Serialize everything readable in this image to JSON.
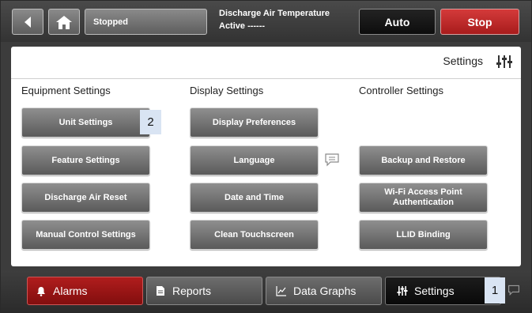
{
  "topbar": {
    "status": "Stopped",
    "info_title": "Discharge Air Temperature",
    "info_status": "Active ------",
    "auto_label": "Auto",
    "stop_label": "Stop"
  },
  "main": {
    "title": "Settings",
    "columns": [
      {
        "heading": "Equipment Settings",
        "buttons": [
          "Unit Settings",
          "Feature Settings",
          "Discharge Air Reset",
          "Manual Control Settings"
        ]
      },
      {
        "heading": "Display Settings",
        "buttons": [
          "Display Preferences",
          "Language",
          "Date and Time",
          "Clean Touchscreen"
        ]
      },
      {
        "heading": "Controller Settings",
        "buttons": [
          "Backup and Restore",
          "Wi-Fi Access Point Authentication",
          "LLID Binding"
        ]
      }
    ]
  },
  "markers": {
    "marker_1": "1",
    "marker_2": "2"
  },
  "nav": {
    "alarms": "Alarms",
    "reports": "Reports",
    "data_graphs": "Data Graphs",
    "settings": "Settings"
  },
  "colors": {
    "stop_red": "#b82626",
    "alarms_red": "#9a1414",
    "marker_blue": "#d9e4f3"
  },
  "icons": {
    "back": "back-arrow-icon",
    "home": "home-icon",
    "settings": "sliders-icon",
    "alarms": "bell-icon",
    "reports": "document-icon",
    "data_graphs": "chart-icon",
    "comment": "speech-bubble-icon"
  }
}
